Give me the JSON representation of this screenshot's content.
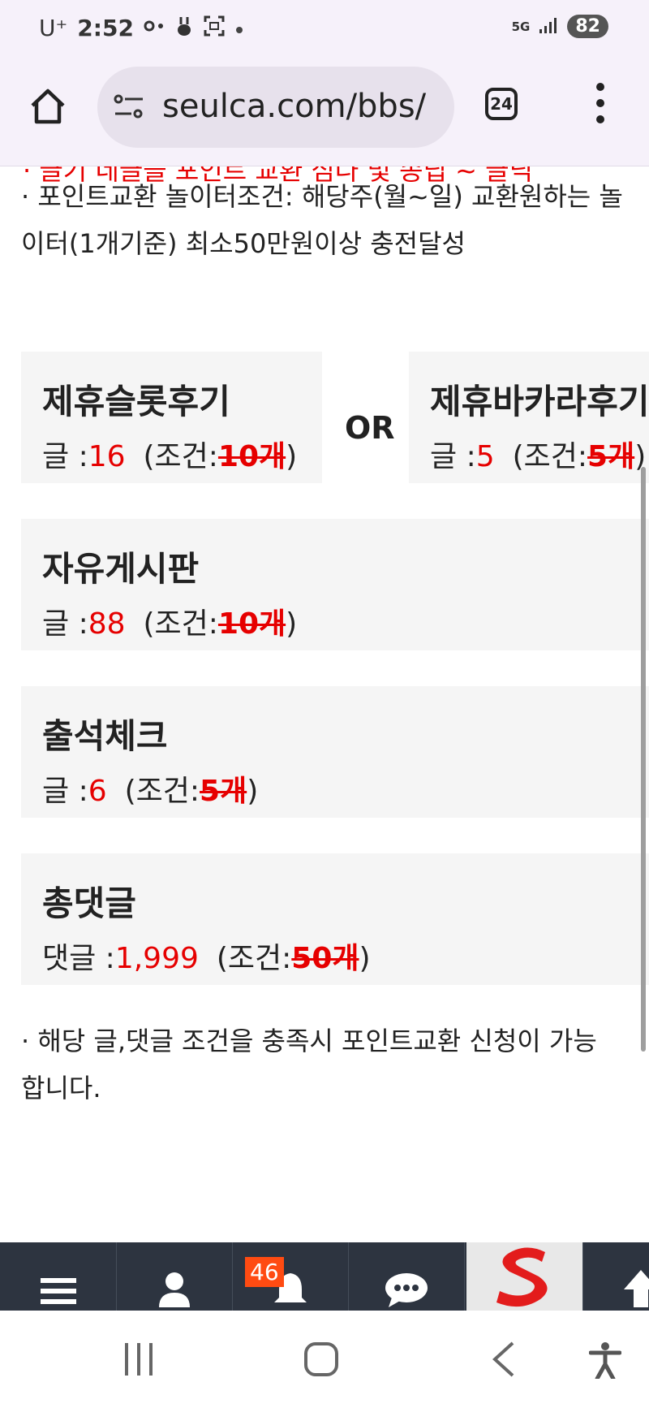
{
  "status_bar": {
    "carrier": "U⁺",
    "time": "2:52",
    "network": "5G",
    "battery": "82"
  },
  "browser": {
    "url": "seulca.com/bbs/",
    "tab_count": "24",
    "icons": [
      "home-icon",
      "site-settings-icon",
      "tabs-icon",
      "more-vert-icon"
    ]
  },
  "content": {
    "cut_red_line": "· 글기 네글을 포인트 교환 심나 및 송딥 ~ 글닉",
    "exchange_condition_line1": "· 포인트교환 놀이터조건: 해당주(월~일) 교환원하는 놀",
    "exchange_condition_line2": "이터(1개기준) 최소50만원이상 충전달성",
    "or_label": "OR",
    "boxes": [
      {
        "title": "제휴슬롯후기",
        "prefix": "글 :",
        "count": "16",
        "cond_open": "(조건:",
        "cond_value": "10개",
        "cond_close": ")"
      },
      {
        "title": "제휴바카라후기",
        "prefix": "글 :",
        "count": "5",
        "cond_open": "(조건:",
        "cond_value": "5개",
        "cond_close": ")"
      },
      {
        "title": "자유게시판",
        "prefix": "글 :",
        "count": "88",
        "cond_open": "(조건:",
        "cond_value": "10개",
        "cond_close": ")"
      },
      {
        "title": "출석체크",
        "prefix": "글 :",
        "count": "6",
        "cond_open": "(조건:",
        "cond_value": "5개",
        "cond_close": ")"
      },
      {
        "title": "총댓글",
        "prefix": "댓글 :",
        "count": "1,999",
        "cond_open": "(조건:",
        "cond_value": "50개",
        "cond_close": ")"
      }
    ],
    "footer_note_line1": "· 해당 글,댓글 조건을 충족시 포인트교환 신청이 가능",
    "footer_note_line2": "합니다."
  },
  "site_nav": {
    "notification_count": "46",
    "icons": [
      "menu-icon",
      "user-icon",
      "bell-icon",
      "chat-icon",
      "site-logo",
      "scroll-top-icon"
    ]
  },
  "colors": {
    "accent_red": "#e60000",
    "nav_bg": "#2d3440",
    "badge": "#ff4b12",
    "box_bg": "#f5f5f5"
  }
}
